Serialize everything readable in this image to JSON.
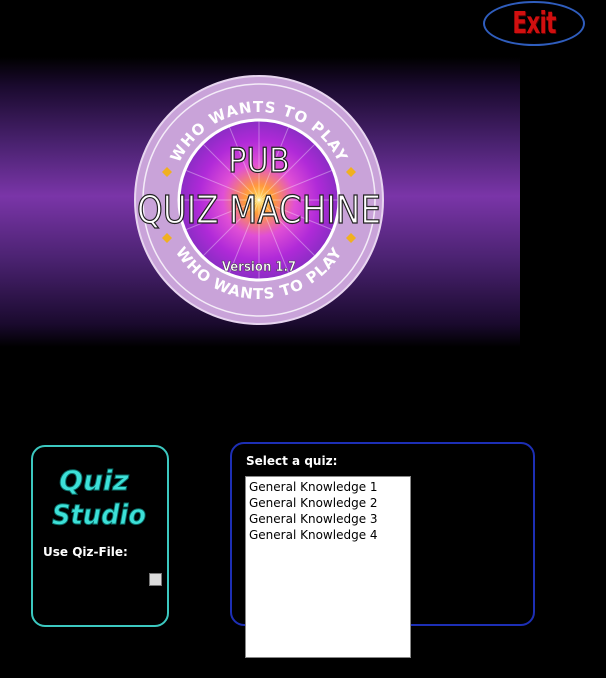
{
  "exit": {
    "label": "Exit"
  },
  "logo": {
    "arc_top": "WHO WANTS TO PLAY",
    "arc_bottom": "WHO WANTS TO PLAY",
    "title_line1": "PUB",
    "title_line2": "QUIZ MACHINE",
    "version": "Version 1.7"
  },
  "studio": {
    "logo_line1": "Quiz",
    "logo_line2": "Studio",
    "use_file_label": "Use Qiz-File:",
    "use_file_checked": false
  },
  "quiz": {
    "select_label": "Select a quiz:",
    "items": [
      "General Knowledge 1",
      "General Knowledge 2",
      "General Knowledge 3",
      "General Knowledge 4"
    ]
  },
  "colors": {
    "exit_text": "#d10f0f",
    "exit_border": "#2f5dbd",
    "studio_border": "#3cc8c0",
    "quiz_border": "#1d2fb5",
    "banner_purple": "#7a35a8"
  }
}
